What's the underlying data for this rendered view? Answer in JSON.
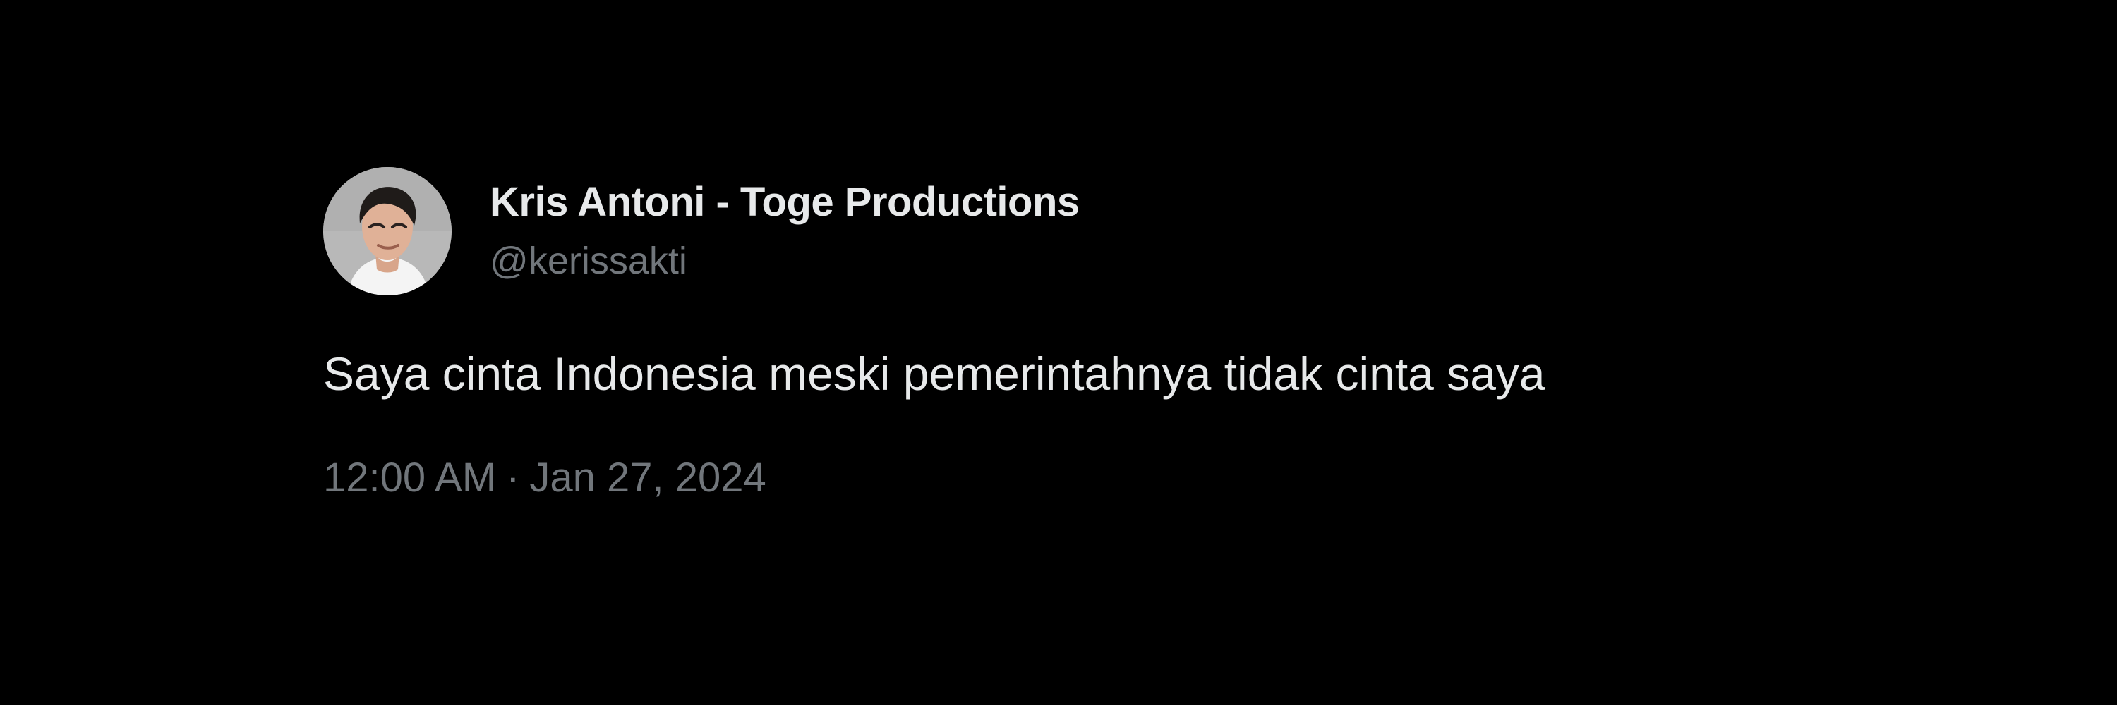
{
  "tweet": {
    "author": {
      "display_name": "Kris Antoni - Toge Productions",
      "handle": "@kerissakti",
      "avatar": "avatar-photo"
    },
    "text": "Saya cinta Indonesia meski pemerintahnya tidak cinta saya",
    "time": "12:00 AM",
    "separator": "·",
    "date": "Jan 27, 2024"
  },
  "colors": {
    "background": "#000000",
    "primary_text": "#e7e9ea",
    "secondary_text": "#71767b"
  }
}
